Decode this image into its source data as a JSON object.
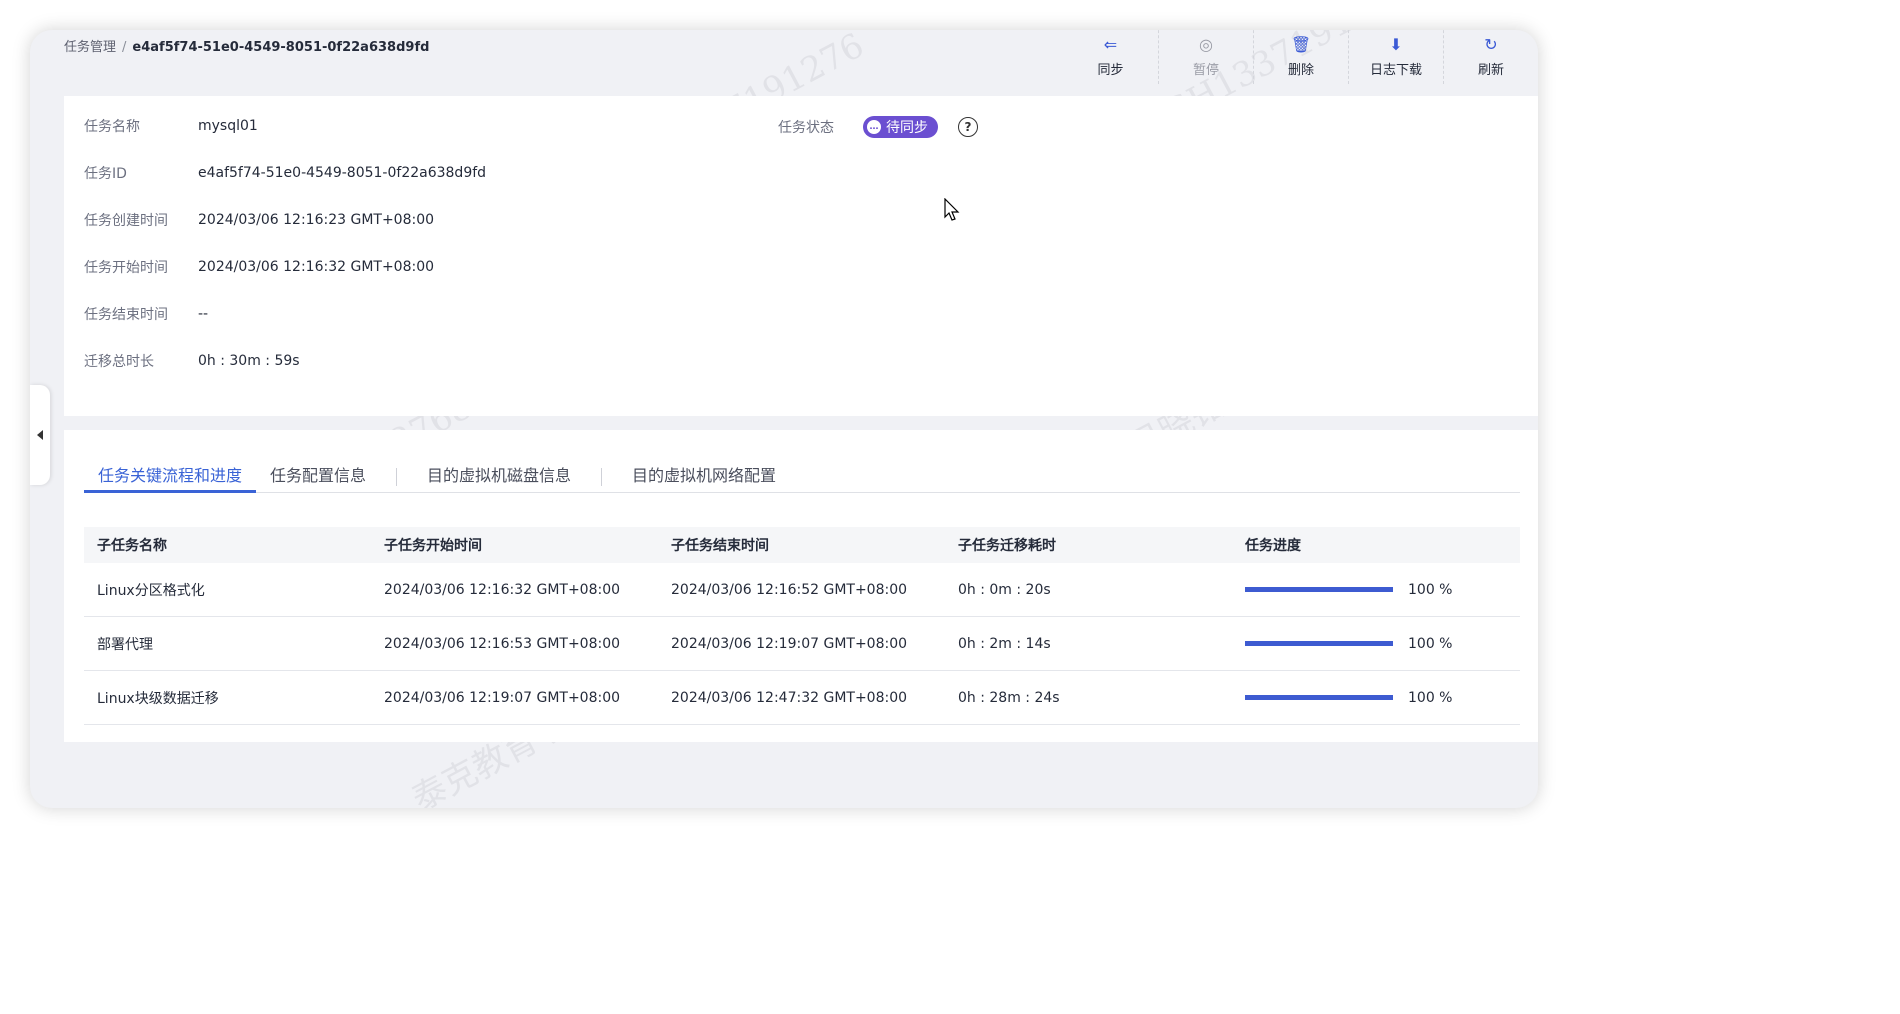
{
  "breadcrumb": {
    "parent": "任务管理",
    "separator": "/",
    "current": "e4af5f74-51e0-4549-8051-0f22a638d9fd"
  },
  "toolbar": {
    "items": [
      {
        "label": "同步",
        "icon": "sync-icon",
        "glyph": "⇐"
      },
      {
        "label": "暂停",
        "icon": "pause-icon",
        "glyph": "◎"
      },
      {
        "label": "删除",
        "icon": "trash-icon",
        "glyph": "🗑"
      },
      {
        "label": "日志下载",
        "icon": "download-log-icon",
        "glyph": "⬇"
      },
      {
        "label": "刷新",
        "icon": "refresh-icon",
        "glyph": "↻"
      }
    ]
  },
  "task_info": {
    "name_label": "任务名称",
    "name_value": "mysql01",
    "id_label": "任务ID",
    "id_value": "e4af5f74-51e0-4549-8051-0f22a638d9fd",
    "created_label": "任务创建时间",
    "created_value": "2024/03/06 12:16:23 GMT+08:00",
    "started_label": "任务开始时间",
    "started_value": "2024/03/06 12:16:32 GMT+08:00",
    "ended_label": "任务结束时间",
    "ended_value": "--",
    "duration_label": "迁移总时长",
    "duration_value": "0h : 30m : 59s",
    "status_label": "任务状态",
    "status_value": "待同步",
    "status_icon": "…",
    "status_color": "#6b4fd1"
  },
  "tabs": [
    {
      "label": "任务关键流程和进度",
      "active": true
    },
    {
      "label": "任务配置信息",
      "active": false
    },
    {
      "label": "目的虚拟机磁盘信息",
      "active": false
    },
    {
      "label": "目的虚拟机网络配置",
      "active": false
    }
  ],
  "table": {
    "headers": [
      "子任务名称",
      "子任务开始时间",
      "子任务结束时间",
      "子任务迁移耗时",
      "任务进度"
    ],
    "rows": [
      {
        "name": "Linux分区格式化",
        "start": "2024/03/06 12:16:32 GMT+08:00",
        "end": "2024/03/06 12:16:52 GMT+08:00",
        "duration": "0h : 0m : 20s",
        "progress": 100,
        "progress_label": "100 %"
      },
      {
        "name": "部署代理",
        "start": "2024/03/06 12:16:53 GMT+08:00",
        "end": "2024/03/06 12:19:07 GMT+08:00",
        "duration": "0h : 2m : 14s",
        "progress": 100,
        "progress_label": "100 %"
      },
      {
        "name": "Linux块级数据迁移",
        "start": "2024/03/06 12:19:07 GMT+08:00",
        "end": "2024/03/06 12:47:32 GMT+08:00",
        "duration": "0h : 28m : 24s",
        "progress": 100,
        "progress_label": "100 %"
      }
    ]
  },
  "colors": {
    "accent": "#3a63d6",
    "progress": "#3d5bd1",
    "badge": "#6b4fd1"
  }
}
